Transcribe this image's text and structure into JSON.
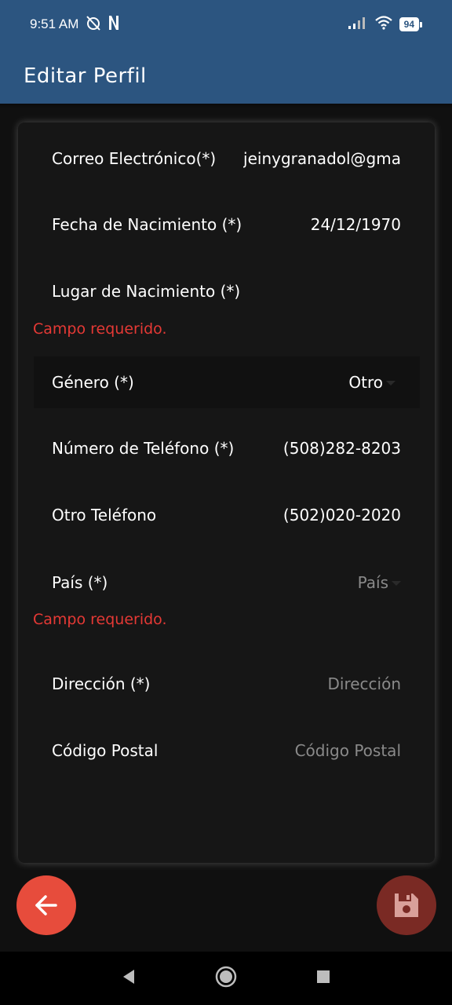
{
  "status_bar": {
    "time": "9:51 AM",
    "battery": "94",
    "icons": [
      "alarm-off-icon",
      "netflix-n-icon",
      "signal-icon",
      "wifi-icon",
      "battery-icon"
    ]
  },
  "app_bar": {
    "title": "Editar Perfil"
  },
  "form": {
    "email": {
      "label": "Correo Electrónico(*)",
      "value": "jeinygranadol@gma"
    },
    "birth_date": {
      "label": "Fecha de Nacimiento (*)",
      "value": "24/12/1970"
    },
    "birth_place": {
      "label": "Lugar de Nacimiento (*)",
      "value": "",
      "error": "Campo requerido."
    },
    "gender": {
      "label": "Género (*)",
      "value": "Otro"
    },
    "phone": {
      "label": "Número de Teléfono (*)",
      "value": "(508)282-8203"
    },
    "other_phone": {
      "label": "Otro Teléfono",
      "value": "(502)020-2020"
    },
    "country": {
      "label": "País (*)",
      "placeholder": "País",
      "error": "Campo requerido."
    },
    "address": {
      "label": "Dirección (*)",
      "placeholder": "Dirección"
    },
    "postal_code": {
      "label": "Código Postal",
      "placeholder": "Código Postal"
    }
  },
  "actions": {
    "back_icon": "arrow-left-icon",
    "save_icon": "floppy-disk-icon"
  },
  "colors": {
    "app_bar": "#2c5580",
    "background": "#101010",
    "card": "#161616",
    "error": "#e53935",
    "back_fab": "#e74c3c",
    "save_fab": "#7a2a24"
  }
}
